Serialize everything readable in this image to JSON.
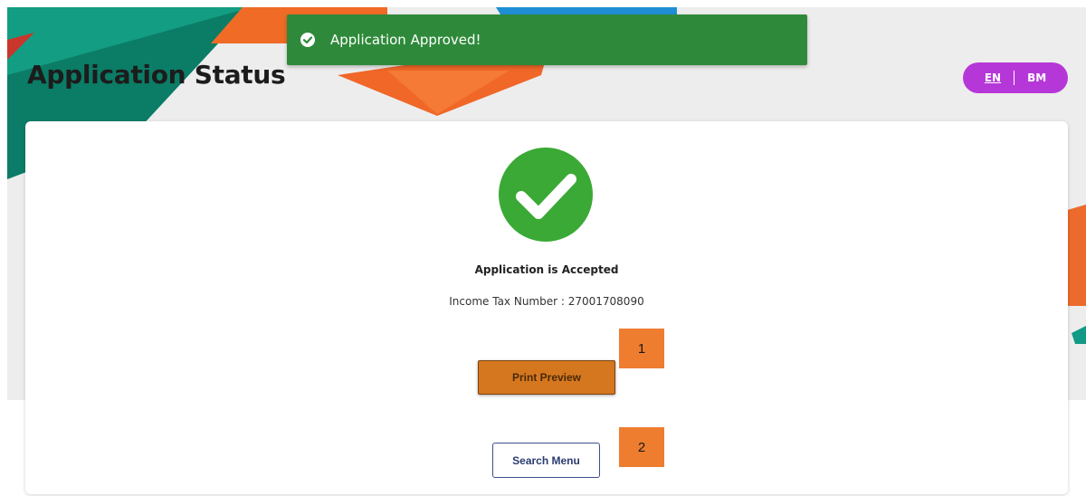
{
  "header": {
    "title": "Application Status"
  },
  "toast": {
    "message": "Application Approved!",
    "icon": "check-circle-icon",
    "color": "#2e8a3a"
  },
  "language": {
    "options": [
      "EN",
      "BM"
    ],
    "selected": "EN",
    "color": "#b637d8"
  },
  "status": {
    "icon": "check-circle-icon",
    "icon_color": "#3aa935",
    "message": "Application is Accepted",
    "tax_number_line": "Income Tax Number : 27001708090"
  },
  "actions": {
    "print_preview_label": "Print Preview",
    "search_menu_label": "Search Menu"
  },
  "annotations": {
    "markers": [
      "1",
      "2"
    ]
  }
}
